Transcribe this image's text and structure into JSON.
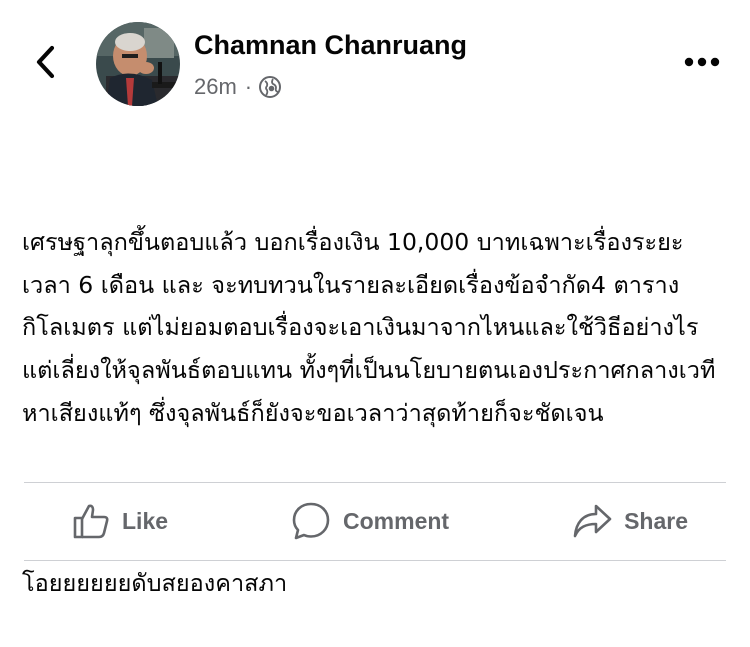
{
  "post": {
    "author": "Chamnan Chanruang",
    "time": "26m",
    "separator": "·",
    "privacy_icon": "globe-icon",
    "paragraphs": [
      "เศรษฐาลุกขึ้นตอบแล้ว บอกเรื่องเงิน 10,000 บาทเฉพาะเรื่องระยะเวลา 6 เดือน และ จะทบทวนในรายละเอียดเรื่องข้อจำกัด4 ตารางกิโลเมตร แต่ไม่ยอมตอบเรื่องจะเอาเงินมาจากไหนและใช้วิธีอย่างไร แต่เลี่ยงให้จุลพันธ์ตอบแทน ทั้งๆที่เป็นนโยบายตนเองประกาศกลางเวทีหาเสียงแท้ๆ ซึ่งจุลพันธ์ก็ยังจะขอเวลาว่าสุดท้ายก็จะชัดเจน",
      "โอยยยยยยดับสยองคาสภา"
    ]
  },
  "header": {
    "back_icon": "chevron-left-icon",
    "more_icon": "more-dots-icon"
  },
  "actions": {
    "like_label": "Like",
    "comment_label": "Comment",
    "share_label": "Share"
  },
  "colors": {
    "text": "#050505",
    "secondary": "#65676b",
    "divider": "#ced0d4"
  }
}
